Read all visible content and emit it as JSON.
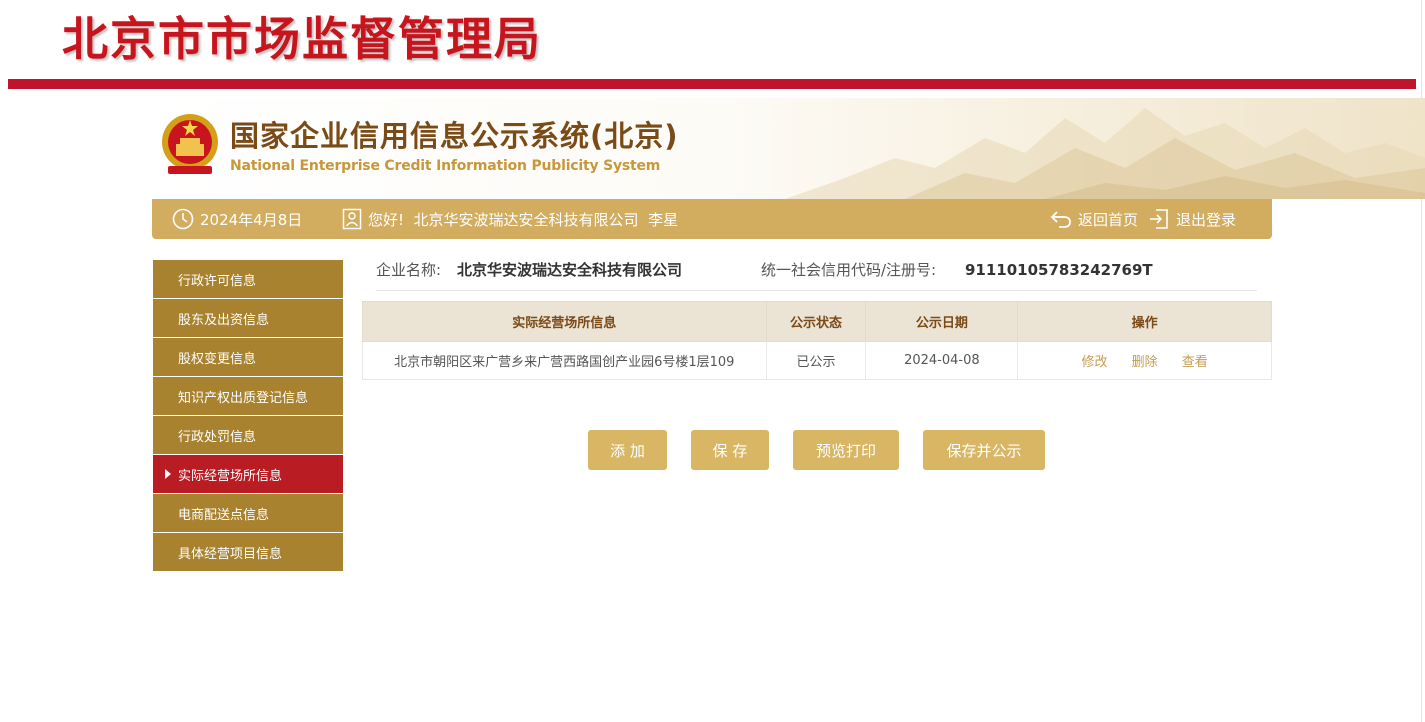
{
  "header": {
    "title": "北京市市场监督管理局"
  },
  "banner": {
    "system_title": "国家企业信用信息公示系统(北京)",
    "system_subtitle": "National Enterprise Credit Information Publicity System"
  },
  "nav": {
    "date": "2024年4月8日",
    "greeting": "您好!  北京华安波瑞达安全科技有限公司  李星",
    "home_label": "返回首页",
    "logout_label": "退出登录"
  },
  "sidebar": {
    "items": [
      {
        "label": "行政许可信息",
        "active": false
      },
      {
        "label": "股东及出资信息",
        "active": false
      },
      {
        "label": "股权变更信息",
        "active": false
      },
      {
        "label": "知识产权出质登记信息",
        "active": false
      },
      {
        "label": "行政处罚信息",
        "active": false
      },
      {
        "label": "实际经营场所信息",
        "active": true
      },
      {
        "label": "电商配送点信息",
        "active": false
      },
      {
        "label": "具体经营项目信息",
        "active": false
      }
    ]
  },
  "company": {
    "name_label": "企业名称:",
    "name": "北京华安波瑞达安全科技有限公司",
    "code_label": "统一社会信用代码/注册号:",
    "code": "91110105783242769T"
  },
  "table": {
    "headers": [
      "实际经营场所信息",
      "公示状态",
      "公示日期",
      "操作"
    ],
    "rows": [
      {
        "address": "北京市朝阳区来广营乡来广营西路国创产业园6号楼1层109",
        "status": "已公示",
        "date": "2024-04-08",
        "actions": [
          "修改",
          "删除",
          "查看"
        ]
      }
    ]
  },
  "buttons": {
    "add": "添 加",
    "save": "保 存",
    "preview_print": "预览打印",
    "save_publish": "保存并公示"
  },
  "colors": {
    "brand_red": "#c8151d",
    "gold": "#d2ac5f",
    "sidebar": "#a8822f",
    "active": "#b91c22",
    "button": "#d8b664"
  }
}
